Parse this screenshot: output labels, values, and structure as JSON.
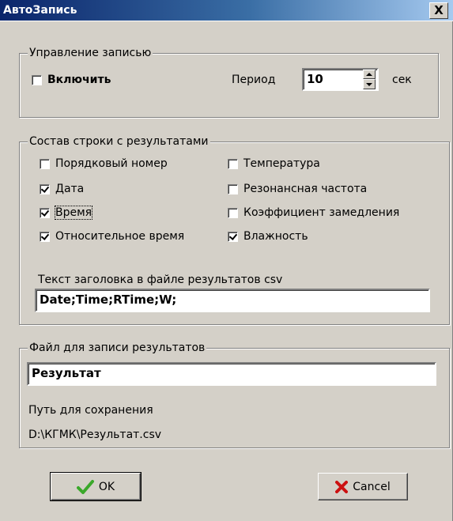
{
  "window": {
    "title": "АвтоЗапись",
    "close_glyph": "X"
  },
  "recording": {
    "legend": "Управление записью",
    "enable_label": "Включить",
    "enable_checked": false,
    "period_label": "Период",
    "period_value": "10",
    "unit_label": "сек"
  },
  "result_row": {
    "legend": "Состав строки с результатами",
    "options": [
      {
        "label": "Порядковый номер",
        "checked": false
      },
      {
        "label": "Дата",
        "checked": true
      },
      {
        "label": "Время",
        "checked": true
      },
      {
        "label": "Относительное время",
        "checked": true
      },
      {
        "label": "Температура",
        "checked": false
      },
      {
        "label": "Резонансная частота",
        "checked": false
      },
      {
        "label": "Коэффициент замедления",
        "checked": false
      },
      {
        "label": "Влажность",
        "checked": true
      }
    ],
    "header_label": "Текст заголовка в файле результатов csv",
    "header_value": "Date;Time;RTime;W;"
  },
  "file": {
    "legend": "Файл для записи результатов",
    "name_value": "Результат",
    "path_label": "Путь для сохранения",
    "path_value": "D:\\КГМК\\Результат.csv"
  },
  "buttons": {
    "ok_label": "OK",
    "cancel_label": "Cancel"
  },
  "colors": {
    "title_bar": "#0a246a",
    "ok_icon": "#3aa82a",
    "cancel_icon": "#cc1111",
    "dialog_bg": "#d4d0c8"
  }
}
